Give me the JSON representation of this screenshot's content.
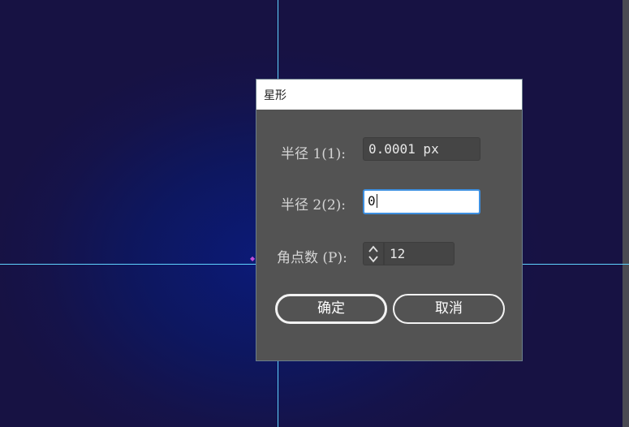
{
  "dialog": {
    "title": "星形",
    "radius1": {
      "label": "半径 1(1):",
      "value": "0.0001 px"
    },
    "radius2": {
      "label": "半径 2(2):",
      "value": "0"
    },
    "points": {
      "label": "角点数 (P):",
      "value": "12"
    },
    "ok_label": "确定",
    "cancel_label": "取消"
  },
  "colors": {
    "canvas": "#0d1760",
    "guide": "#5fd3ff",
    "dialog_bg": "#535353",
    "focus": "#3d8fe0"
  }
}
